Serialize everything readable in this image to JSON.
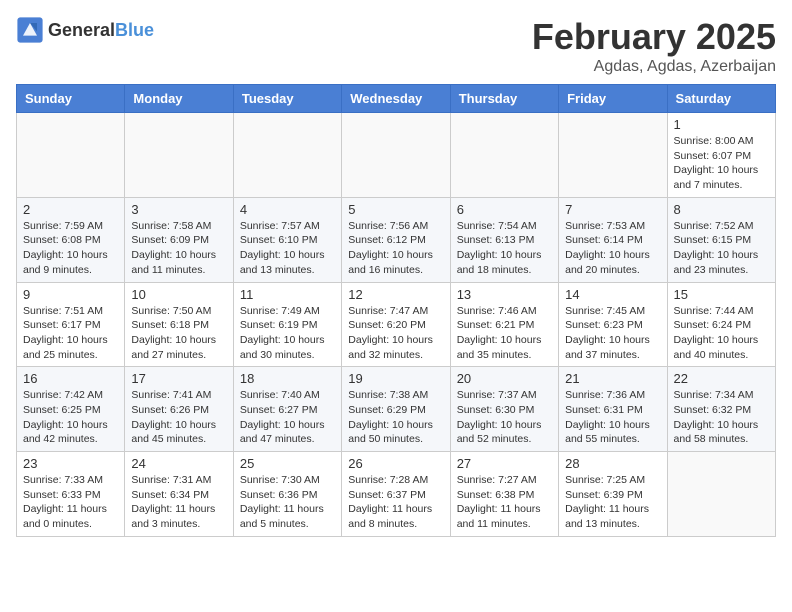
{
  "header": {
    "logo_general": "General",
    "logo_blue": "Blue",
    "month_year": "February 2025",
    "location": "Agdas, Agdas, Azerbaijan"
  },
  "days_of_week": [
    "Sunday",
    "Monday",
    "Tuesday",
    "Wednesday",
    "Thursday",
    "Friday",
    "Saturday"
  ],
  "weeks": [
    [
      {
        "day": "",
        "info": ""
      },
      {
        "day": "",
        "info": ""
      },
      {
        "day": "",
        "info": ""
      },
      {
        "day": "",
        "info": ""
      },
      {
        "day": "",
        "info": ""
      },
      {
        "day": "",
        "info": ""
      },
      {
        "day": "1",
        "info": "Sunrise: 8:00 AM\nSunset: 6:07 PM\nDaylight: 10 hours and 7 minutes."
      }
    ],
    [
      {
        "day": "2",
        "info": "Sunrise: 7:59 AM\nSunset: 6:08 PM\nDaylight: 10 hours and 9 minutes."
      },
      {
        "day": "3",
        "info": "Sunrise: 7:58 AM\nSunset: 6:09 PM\nDaylight: 10 hours and 11 minutes."
      },
      {
        "day": "4",
        "info": "Sunrise: 7:57 AM\nSunset: 6:10 PM\nDaylight: 10 hours and 13 minutes."
      },
      {
        "day": "5",
        "info": "Sunrise: 7:56 AM\nSunset: 6:12 PM\nDaylight: 10 hours and 16 minutes."
      },
      {
        "day": "6",
        "info": "Sunrise: 7:54 AM\nSunset: 6:13 PM\nDaylight: 10 hours and 18 minutes."
      },
      {
        "day": "7",
        "info": "Sunrise: 7:53 AM\nSunset: 6:14 PM\nDaylight: 10 hours and 20 minutes."
      },
      {
        "day": "8",
        "info": "Sunrise: 7:52 AM\nSunset: 6:15 PM\nDaylight: 10 hours and 23 minutes."
      }
    ],
    [
      {
        "day": "9",
        "info": "Sunrise: 7:51 AM\nSunset: 6:17 PM\nDaylight: 10 hours and 25 minutes."
      },
      {
        "day": "10",
        "info": "Sunrise: 7:50 AM\nSunset: 6:18 PM\nDaylight: 10 hours and 27 minutes."
      },
      {
        "day": "11",
        "info": "Sunrise: 7:49 AM\nSunset: 6:19 PM\nDaylight: 10 hours and 30 minutes."
      },
      {
        "day": "12",
        "info": "Sunrise: 7:47 AM\nSunset: 6:20 PM\nDaylight: 10 hours and 32 minutes."
      },
      {
        "day": "13",
        "info": "Sunrise: 7:46 AM\nSunset: 6:21 PM\nDaylight: 10 hours and 35 minutes."
      },
      {
        "day": "14",
        "info": "Sunrise: 7:45 AM\nSunset: 6:23 PM\nDaylight: 10 hours and 37 minutes."
      },
      {
        "day": "15",
        "info": "Sunrise: 7:44 AM\nSunset: 6:24 PM\nDaylight: 10 hours and 40 minutes."
      }
    ],
    [
      {
        "day": "16",
        "info": "Sunrise: 7:42 AM\nSunset: 6:25 PM\nDaylight: 10 hours and 42 minutes."
      },
      {
        "day": "17",
        "info": "Sunrise: 7:41 AM\nSunset: 6:26 PM\nDaylight: 10 hours and 45 minutes."
      },
      {
        "day": "18",
        "info": "Sunrise: 7:40 AM\nSunset: 6:27 PM\nDaylight: 10 hours and 47 minutes."
      },
      {
        "day": "19",
        "info": "Sunrise: 7:38 AM\nSunset: 6:29 PM\nDaylight: 10 hours and 50 minutes."
      },
      {
        "day": "20",
        "info": "Sunrise: 7:37 AM\nSunset: 6:30 PM\nDaylight: 10 hours and 52 minutes."
      },
      {
        "day": "21",
        "info": "Sunrise: 7:36 AM\nSunset: 6:31 PM\nDaylight: 10 hours and 55 minutes."
      },
      {
        "day": "22",
        "info": "Sunrise: 7:34 AM\nSunset: 6:32 PM\nDaylight: 10 hours and 58 minutes."
      }
    ],
    [
      {
        "day": "23",
        "info": "Sunrise: 7:33 AM\nSunset: 6:33 PM\nDaylight: 11 hours and 0 minutes."
      },
      {
        "day": "24",
        "info": "Sunrise: 7:31 AM\nSunset: 6:34 PM\nDaylight: 11 hours and 3 minutes."
      },
      {
        "day": "25",
        "info": "Sunrise: 7:30 AM\nSunset: 6:36 PM\nDaylight: 11 hours and 5 minutes."
      },
      {
        "day": "26",
        "info": "Sunrise: 7:28 AM\nSunset: 6:37 PM\nDaylight: 11 hours and 8 minutes."
      },
      {
        "day": "27",
        "info": "Sunrise: 7:27 AM\nSunset: 6:38 PM\nDaylight: 11 hours and 11 minutes."
      },
      {
        "day": "28",
        "info": "Sunrise: 7:25 AM\nSunset: 6:39 PM\nDaylight: 11 hours and 13 minutes."
      },
      {
        "day": "",
        "info": ""
      }
    ]
  ]
}
